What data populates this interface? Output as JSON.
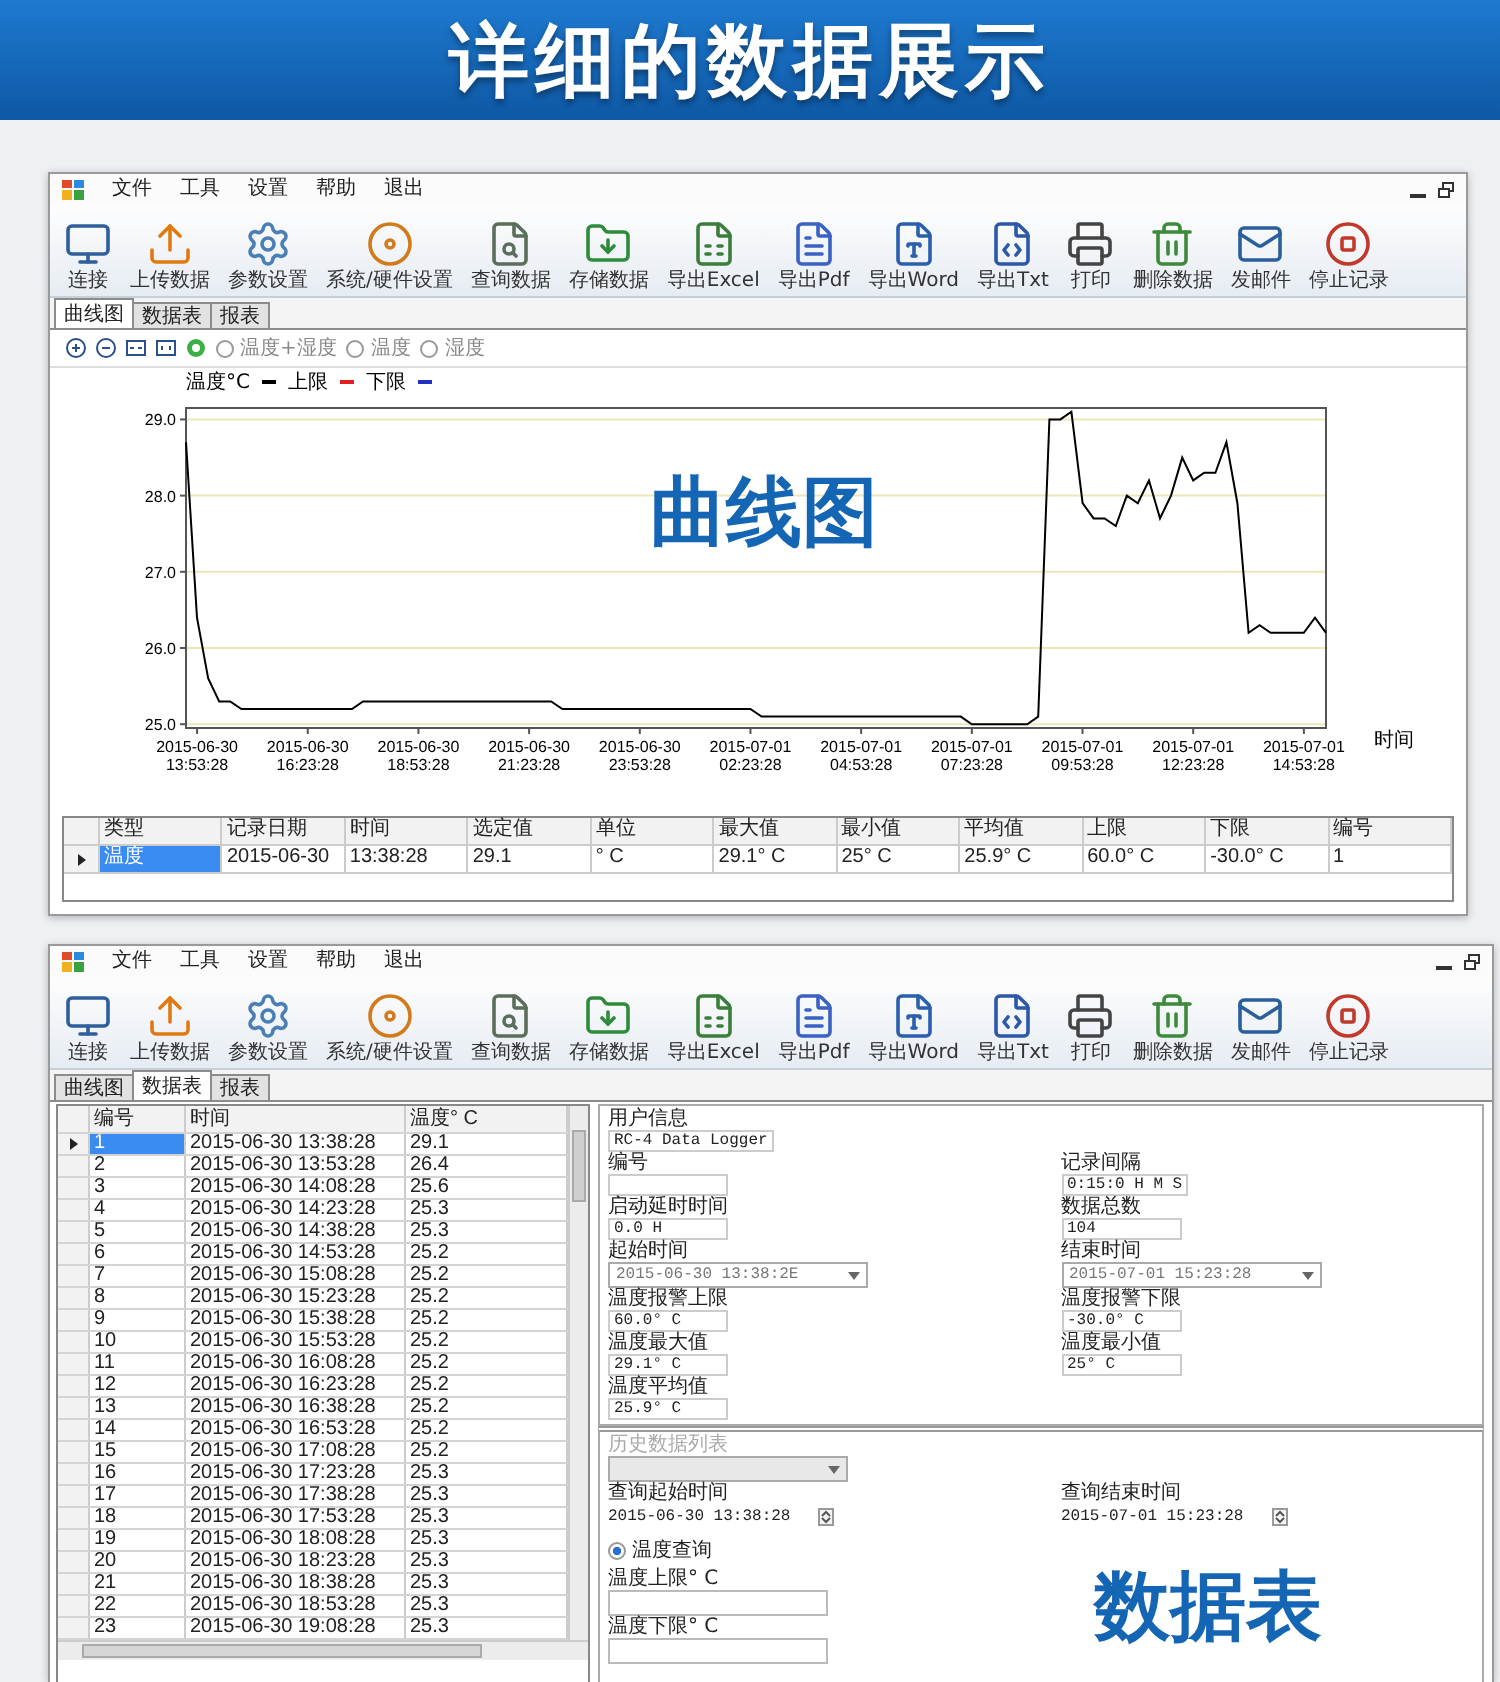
{
  "banner": {
    "title": "详细的数据展示"
  },
  "chart_window": {
    "menu": [
      "文件",
      "工具",
      "设置",
      "帮助",
      "退出"
    ],
    "toolbar": [
      "连接",
      "上传数据",
      "参数设置",
      "系统/硬件设置",
      "查询数据",
      "存储数据",
      "导出Excel",
      "导出Pdf",
      "导出Word",
      "导出Txt",
      "打印",
      "删除数据",
      "发邮件",
      "停止记录"
    ],
    "tabs": [
      {
        "label": "曲线图",
        "selected": true
      },
      {
        "label": "数据表",
        "selected": false
      },
      {
        "label": "报表",
        "selected": false
      }
    ],
    "view_options": [
      {
        "label": "温度+湿度",
        "selected": false
      },
      {
        "label": "温度",
        "selected": false
      },
      {
        "label": "湿度",
        "selected": false
      }
    ],
    "chart": {
      "overlay_label": "曲线图",
      "limit_legend": [
        {
          "label": "上限",
          "color": "#e02020"
        },
        {
          "label": "下限",
          "color": "#2030c0"
        }
      ],
      "chart_data": {
        "type": "line",
        "xlabel": "时间",
        "grid": true,
        "ylim": [
          24.95,
          29.15
        ],
        "yticks": [
          {
            "value": 25,
            "label": "25.0"
          },
          {
            "value": 26,
            "label": "26.0"
          },
          {
            "value": 27,
            "label": "27.0"
          },
          {
            "value": 28,
            "label": "28.0"
          },
          {
            "value": 29,
            "label": "29.0"
          }
        ],
        "categories": [
          null,
          "2015-06-30 13:53:28",
          null,
          null,
          null,
          null,
          null,
          null,
          null,
          null,
          null,
          "2015-06-30 16:23:28",
          null,
          null,
          null,
          null,
          null,
          null,
          null,
          null,
          null,
          "2015-06-30 18:53:28",
          null,
          null,
          null,
          null,
          null,
          null,
          null,
          null,
          null,
          "2015-06-30 21:23:28",
          null,
          null,
          null,
          null,
          null,
          null,
          null,
          null,
          null,
          "2015-06-30 23:53:28",
          null,
          null,
          null,
          null,
          null,
          null,
          null,
          null,
          null,
          "2015-07-01 02:23:28",
          null,
          null,
          null,
          null,
          null,
          null,
          null,
          null,
          null,
          "2015-07-01 04:53:28",
          null,
          null,
          null,
          null,
          null,
          null,
          null,
          null,
          null,
          "2015-07-01 07:23:28",
          null,
          null,
          null,
          null,
          null,
          null,
          null,
          null,
          null,
          "2015-07-01 09:53:28",
          null,
          null,
          null,
          null,
          null,
          null,
          null,
          null,
          null,
          "2015-07-01 12:23:28",
          null,
          null,
          null,
          null,
          null,
          null,
          null,
          null,
          null,
          "2015-07-01 14:53:28",
          null,
          null
        ],
        "series": [
          {
            "name": "温度°C",
            "color": "#000000",
            "values": [
              28.7,
              26.4,
              25.6,
              25.3,
              25.3,
              25.2,
              25.2,
              25.2,
              25.2,
              25.2,
              25.2,
              25.2,
              25.2,
              25.2,
              25.2,
              25.2,
              25.3,
              25.3,
              25.3,
              25.3,
              25.3,
              25.3,
              25.3,
              25.3,
              25.3,
              25.3,
              25.3,
              25.3,
              25.3,
              25.3,
              25.3,
              25.3,
              25.3,
              25.3,
              25.2,
              25.2,
              25.2,
              25.2,
              25.2,
              25.2,
              25.2,
              25.2,
              25.2,
              25.2,
              25.2,
              25.2,
              25.2,
              25.2,
              25.2,
              25.2,
              25.2,
              25.2,
              25.1,
              25.1,
              25.1,
              25.1,
              25.1,
              25.1,
              25.1,
              25.1,
              25.1,
              25.1,
              25.1,
              25.1,
              25.1,
              25.1,
              25.1,
              25.1,
              25.1,
              25.1,
              25.1,
              25.0,
              25.0,
              25.0,
              25.0,
              25.0,
              25.0,
              25.1,
              29.0,
              29.0,
              29.1,
              27.9,
              27.7,
              27.7,
              27.6,
              28.0,
              27.9,
              28.2,
              27.7,
              28.0,
              28.5,
              28.2,
              28.3,
              28.3,
              28.7,
              27.9,
              26.2,
              26.3,
              26.2,
              26.2,
              26.2,
              26.2,
              26.4,
              26.2
            ]
          }
        ]
      }
    },
    "summary_table": {
      "columns": [
        "类型",
        "记录日期",
        "时间",
        "选定值",
        "单位",
        "最大值",
        "最小值",
        "平均值",
        "上限",
        "下限",
        "编号"
      ],
      "rows": [
        {
          "selected": true,
          "cells": [
            "温度",
            "2015-06-30",
            "13:38:28",
            "29.1",
            "° C",
            "29.1° C",
            "25° C",
            "25.9° C",
            "60.0° C",
            "-30.0° C",
            "1"
          ]
        }
      ]
    }
  },
  "table_window": {
    "menu": [
      "文件",
      "工具",
      "设置",
      "帮助",
      "退出"
    ],
    "toolbar": [
      "连接",
      "上传数据",
      "参数设置",
      "系统/硬件设置",
      "查询数据",
      "存储数据",
      "导出Excel",
      "导出Pdf",
      "导出Word",
      "导出Txt",
      "打印",
      "删除数据",
      "发邮件",
      "停止记录"
    ],
    "tabs": [
      {
        "label": "曲线图",
        "selected": false
      },
      {
        "label": "数据表",
        "selected": true
      },
      {
        "label": "报表",
        "selected": false
      }
    ],
    "data_table": {
      "columns": [
        "编号",
        "时间",
        "温度° C"
      ],
      "rows": [
        {
          "selected": true,
          "cells": [
            "1",
            "2015-06-30 13:38:28",
            "29.1"
          ]
        },
        {
          "selected": false,
          "cells": [
            "2",
            "2015-06-30 13:53:28",
            "26.4"
          ]
        },
        {
          "selected": false,
          "cells": [
            "3",
            "2015-06-30 14:08:28",
            "25.6"
          ]
        },
        {
          "selected": false,
          "cells": [
            "4",
            "2015-06-30 14:23:28",
            "25.3"
          ]
        },
        {
          "selected": false,
          "cells": [
            "5",
            "2015-06-30 14:38:28",
            "25.3"
          ]
        },
        {
          "selected": false,
          "cells": [
            "6",
            "2015-06-30 14:53:28",
            "25.2"
          ]
        },
        {
          "selected": false,
          "cells": [
            "7",
            "2015-06-30 15:08:28",
            "25.2"
          ]
        },
        {
          "selected": false,
          "cells": [
            "8",
            "2015-06-30 15:23:28",
            "25.2"
          ]
        },
        {
          "selected": false,
          "cells": [
            "9",
            "2015-06-30 15:38:28",
            "25.2"
          ]
        },
        {
          "selected": false,
          "cells": [
            "10",
            "2015-06-30 15:53:28",
            "25.2"
          ]
        },
        {
          "selected": false,
          "cells": [
            "11",
            "2015-06-30 16:08:28",
            "25.2"
          ]
        },
        {
          "selected": false,
          "cells": [
            "12",
            "2015-06-30 16:23:28",
            "25.2"
          ]
        },
        {
          "selected": false,
          "cells": [
            "13",
            "2015-06-30 16:38:28",
            "25.2"
          ]
        },
        {
          "selected": false,
          "cells": [
            "14",
            "2015-06-30 16:53:28",
            "25.2"
          ]
        },
        {
          "selected": false,
          "cells": [
            "15",
            "2015-06-30 17:08:28",
            "25.2"
          ]
        },
        {
          "selected": false,
          "cells": [
            "16",
            "2015-06-30 17:23:28",
            "25.3"
          ]
        },
        {
          "selected": false,
          "cells": [
            "17",
            "2015-06-30 17:38:28",
            "25.3"
          ]
        },
        {
          "selected": false,
          "cells": [
            "18",
            "2015-06-30 17:53:28",
            "25.3"
          ]
        },
        {
          "selected": false,
          "cells": [
            "19",
            "2015-06-30 18:08:28",
            "25.3"
          ]
        },
        {
          "selected": false,
          "cells": [
            "20",
            "2015-06-30 18:23:28",
            "25.3"
          ]
        },
        {
          "selected": false,
          "cells": [
            "21",
            "2015-06-30 18:38:28",
            "25.3"
          ]
        },
        {
          "selected": false,
          "cells": [
            "22",
            "2015-06-30 18:53:28",
            "25.3"
          ]
        },
        {
          "selected": false,
          "cells": [
            "23",
            "2015-06-30 19:08:28",
            "25.3"
          ]
        }
      ]
    },
    "user_info": {
      "title": "用户信息",
      "device": "RC-4 Data Logger",
      "fields": [
        {
          "label": "编号",
          "kind": "text"
        },
        {
          "label": "记录间隔",
          "value": "0:15:0 H M S",
          "kind": "text"
        },
        {
          "label": "启动延时时间",
          "value": "0.0 H",
          "kind": "text"
        },
        {
          "label": "数据总数",
          "value": "104",
          "kind": "text"
        },
        {
          "label": "起始时间",
          "value": "2015-06-30 13:38:2E",
          "kind": "dropdown"
        },
        {
          "label": "结束时间",
          "value": "2015-07-01 15:23:28",
          "kind": "dropdown"
        },
        {
          "label": "温度报警上限",
          "value": "60.0° C",
          "kind": "text"
        },
        {
          "label": "温度报警下限",
          "value": "-30.0° C",
          "kind": "text"
        },
        {
          "label": "温度最大值",
          "value": "29.1° C",
          "kind": "text"
        },
        {
          "label": "温度最小值",
          "value": "25° C",
          "kind": "text"
        },
        {
          "label": "温度平均值",
          "value": "25.9° C",
          "kind": "text"
        }
      ]
    },
    "query": {
      "history": {
        "label": "历史数据列表",
        "disabled": true
      },
      "times": [
        {
          "label": "查询起始时间",
          "value": "2015-06-30 13:38:28"
        },
        {
          "label": "查询结束时间",
          "value": "2015-07-01 15:23:28"
        }
      ],
      "mode": {
        "label": "温度查询",
        "selected": true
      },
      "limits": [
        {
          "label": "温度上限° C"
        },
        {
          "label": "温度下限° C"
        }
      ]
    },
    "overlay_label": "数据表"
  }
}
